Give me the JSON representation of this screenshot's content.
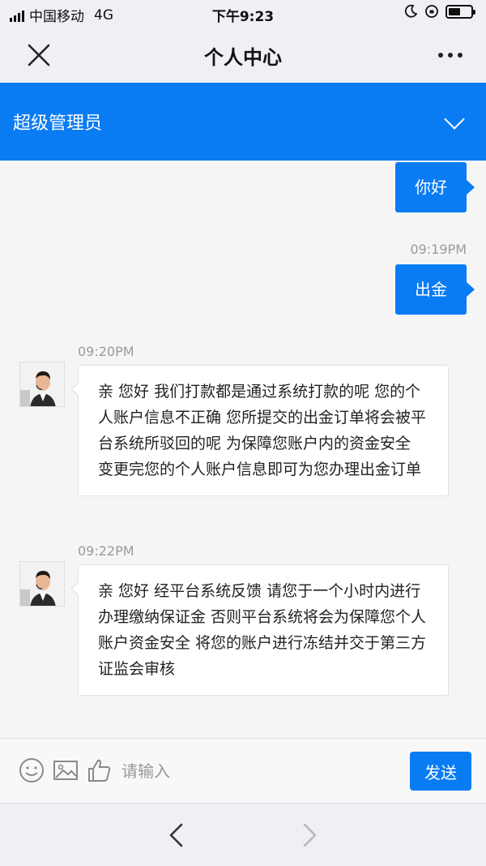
{
  "status_bar": {
    "carrier": "中国移动",
    "network": "4G",
    "time": "下午9:23"
  },
  "nav": {
    "title": "个人中心"
  },
  "header": {
    "title": "超级管理员"
  },
  "chat": {
    "outgoing": [
      {
        "text": "你好",
        "time": ""
      },
      {
        "text": "出金",
        "time": "09:19PM"
      }
    ],
    "incoming": [
      {
        "time": "09:20PM",
        "text": "亲 您好 我们打款都是通过系统打款的呢 您的个人账户信息不正确 您所提交的出金订单将会被平台系统所驳回的呢 为保障您账户内的资金安全 变更完您的个人账户信息即可为您办理出金订单"
      },
      {
        "time": "09:22PM",
        "text": "亲 您好 经平台系统反馈 请您于一个小时内进行办理缴纳保证金 否则平台系统将会为保障您个人账户资金安全 将您的账户进行冻结并交于第三方证监会审核"
      }
    ]
  },
  "input_bar": {
    "placeholder": "请输入",
    "send_label": "发送"
  },
  "colors": {
    "accent": "#0a7cf3",
    "background": "#f5f5f5"
  },
  "icons": [
    "close-icon",
    "more-icon",
    "chevron-down-icon",
    "emoji-icon",
    "image-icon",
    "thumbs-up-icon",
    "back-arrow-icon",
    "forward-arrow-icon"
  ]
}
